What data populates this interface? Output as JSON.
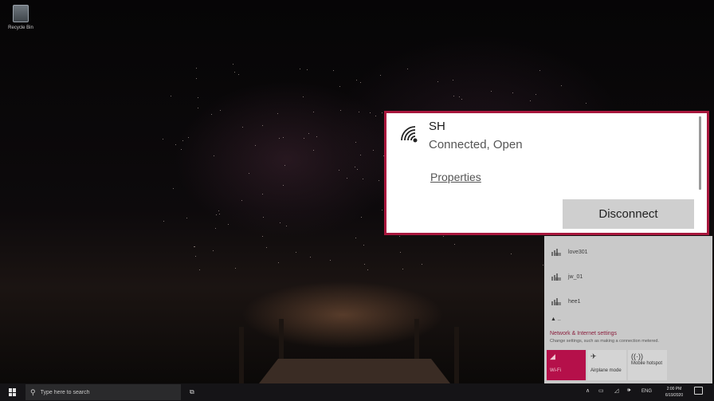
{
  "desktop": {
    "recycle_bin_label": "Recycle Bin"
  },
  "selected_network": {
    "ssid": "SH",
    "status": "Connected, Open",
    "properties_link": "Properties",
    "disconnect_button": "Disconnect"
  },
  "networks": [
    {
      "name": "love301"
    },
    {
      "name": "jw_01"
    },
    {
      "name": "hee1"
    }
  ],
  "network_settings": {
    "title": "Network & Internet settings",
    "subtitle": "Change settings, such as making a connection metered."
  },
  "quick_actions": {
    "wifi": "Wi-Fi",
    "airplane": "Airplane mode",
    "hotspot": "Mobile hotspot"
  },
  "taskbar": {
    "search_placeholder": "Type here to search",
    "language": "ENG",
    "time": "2:00 PM",
    "date": "6/19/2020"
  },
  "colors": {
    "accent": "#a8173d",
    "wifi_tile": "#b5104a"
  }
}
